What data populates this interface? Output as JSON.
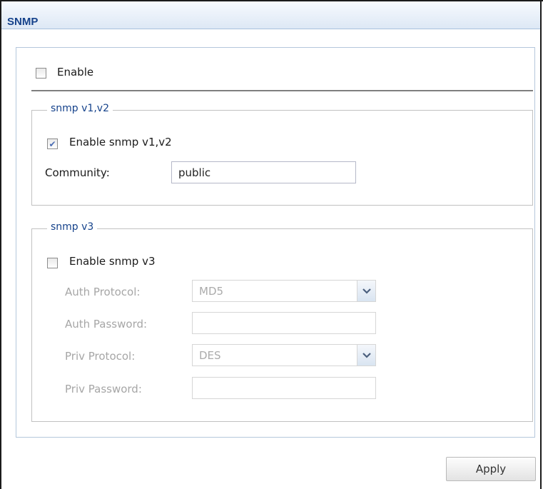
{
  "panel": {
    "title": "SNMP"
  },
  "enable": {
    "label": "Enable",
    "checked": false
  },
  "snmp_v12": {
    "legend": "snmp v1,v2",
    "enable_label": "Enable snmp v1,v2",
    "enabled": true,
    "community_label": "Community:",
    "community_value": "public"
  },
  "snmp_v3": {
    "legend": "snmp v3",
    "enable_label": "Enable snmp v3",
    "enabled": false,
    "auth_protocol_label": "Auth Protocol:",
    "auth_protocol_value": "MD5",
    "auth_password_label": "Auth Password:",
    "auth_password_value": "",
    "priv_protocol_label": "Priv Protocol:",
    "priv_protocol_value": "DES",
    "priv_password_label": "Priv Password:",
    "priv_password_value": ""
  },
  "footer": {
    "apply_label": "Apply"
  },
  "colors": {
    "title": "#15428b",
    "legend": "#15428b",
    "check": "#4a6cb3"
  },
  "icons": {
    "checkmark": "check-icon",
    "dropdown": "chevron-down-icon"
  }
}
